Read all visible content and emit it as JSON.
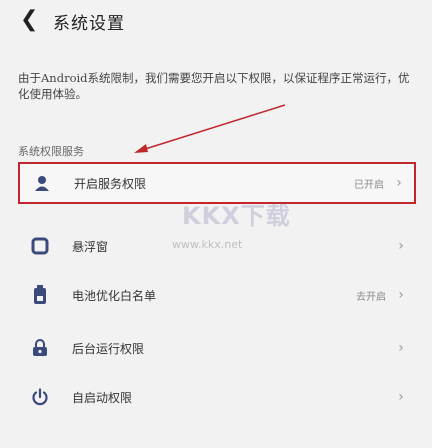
{
  "header": {
    "title": "系统设置"
  },
  "description": "由于Android系统限制，我们需要您开启以下权限，以保证程序正常运行，优化使用体验。",
  "section_label": "系统权限服务",
  "rows": [
    {
      "label": "开启服务权限",
      "value": "已开启",
      "icon": "person-icon"
    },
    {
      "label": "悬浮窗",
      "value": "",
      "icon": "square-icon"
    },
    {
      "label": "电池优化白名单",
      "value": "去开启",
      "icon": "battery-icon"
    },
    {
      "label": "后台运行权限",
      "value": "",
      "icon": "lock-icon"
    },
    {
      "label": "自启动权限",
      "value": "",
      "icon": "power-icon"
    }
  ],
  "watermark": {
    "logo": "KKX下载",
    "url": "www.kkx.net"
  },
  "colors": {
    "highlight_border": "#c0262c",
    "icon_blue": "#3a4a7a"
  }
}
